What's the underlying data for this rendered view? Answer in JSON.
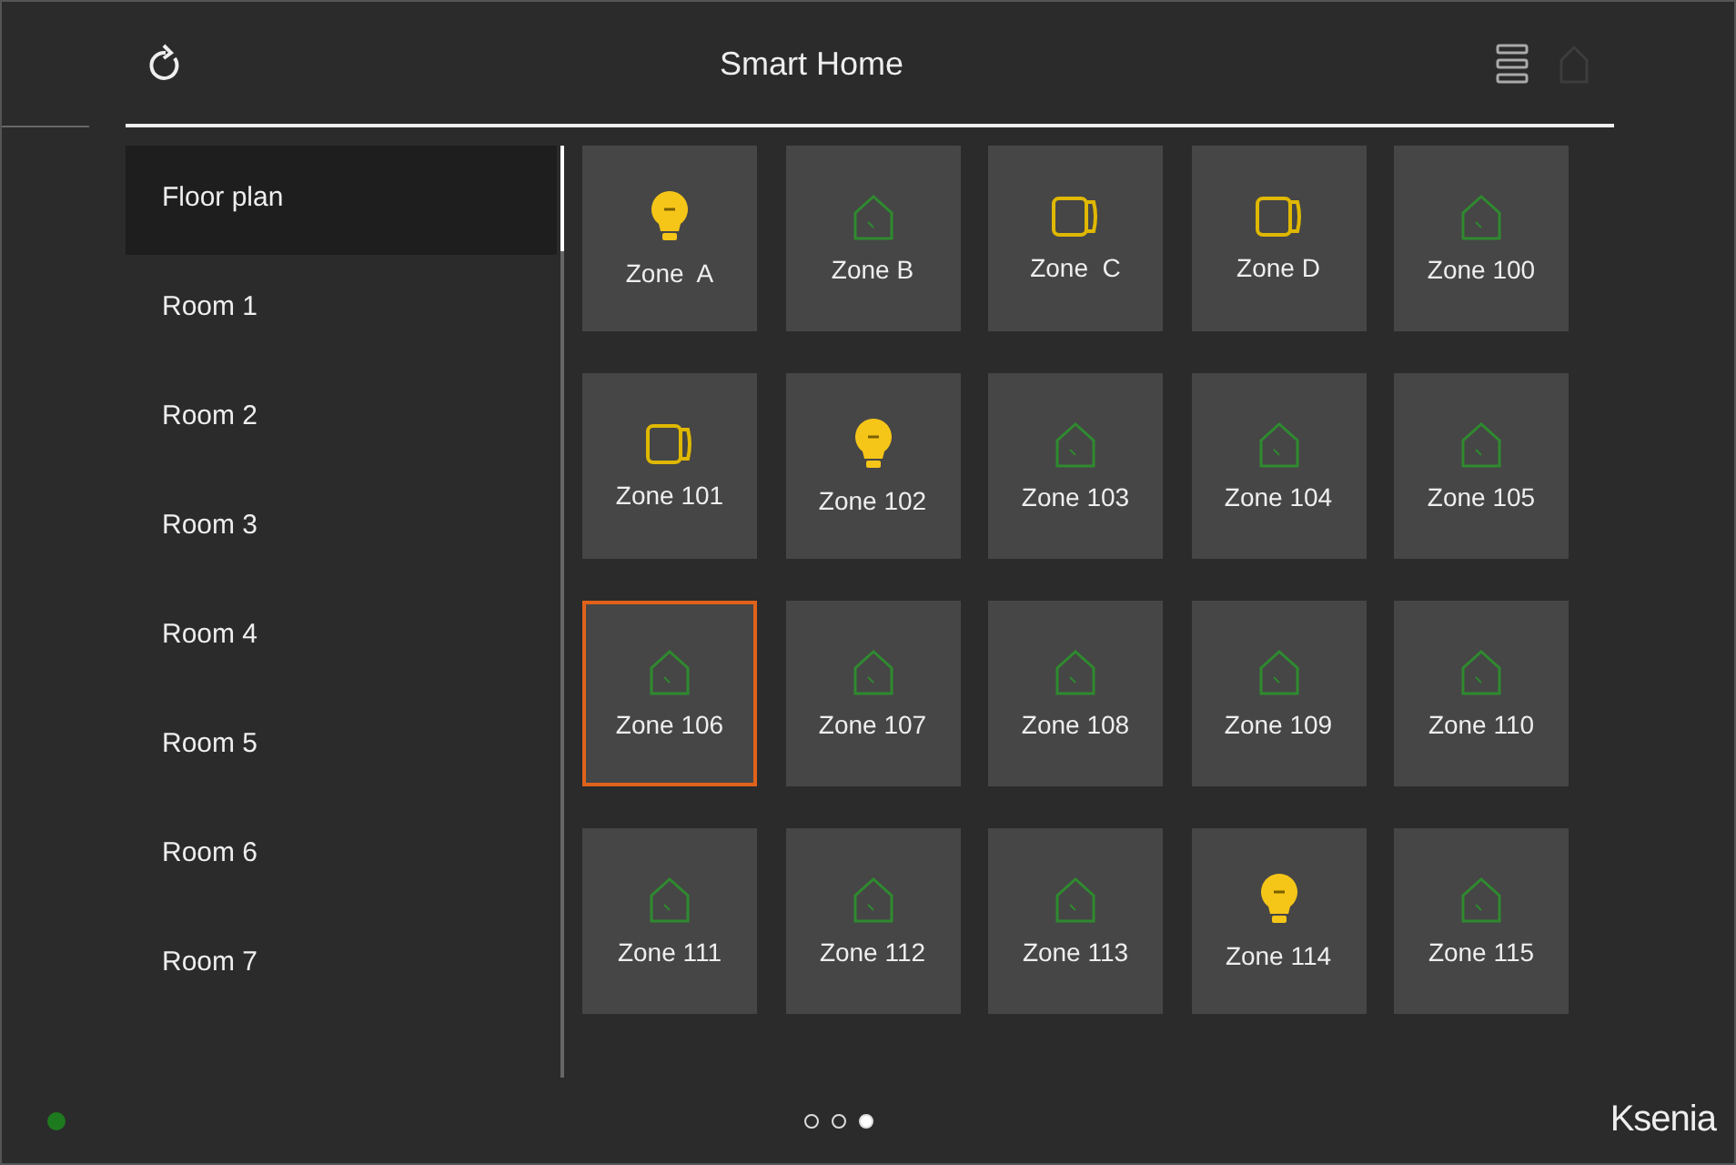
{
  "header": {
    "title": "Smart Home"
  },
  "sidebar": {
    "items": [
      {
        "label": "Floor plan",
        "selected": true
      },
      {
        "label": "Room 1",
        "selected": false
      },
      {
        "label": "Room 2",
        "selected": false
      },
      {
        "label": "Room 3",
        "selected": false
      },
      {
        "label": "Room 4",
        "selected": false
      },
      {
        "label": "Room 5",
        "selected": false
      },
      {
        "label": "Room 6",
        "selected": false
      },
      {
        "label": "Room 7",
        "selected": false
      }
    ]
  },
  "tiles": [
    {
      "label": "Zone  A",
      "kind": "light",
      "selected": false
    },
    {
      "label": "Zone B",
      "kind": "zone",
      "selected": false
    },
    {
      "label": "Zone  C",
      "kind": "shutter",
      "selected": false
    },
    {
      "label": "Zone D",
      "kind": "shutter",
      "selected": false
    },
    {
      "label": "Zone 100",
      "kind": "zone",
      "selected": false
    },
    {
      "label": "Zone 101",
      "kind": "shutter",
      "selected": false
    },
    {
      "label": "Zone 102",
      "kind": "light",
      "selected": false
    },
    {
      "label": "Zone 103",
      "kind": "zone",
      "selected": false
    },
    {
      "label": "Zone 104",
      "kind": "zone",
      "selected": false
    },
    {
      "label": "Zone 105",
      "kind": "zone",
      "selected": false
    },
    {
      "label": "Zone 106",
      "kind": "zone",
      "selected": true
    },
    {
      "label": "Zone 107",
      "kind": "zone",
      "selected": false
    },
    {
      "label": "Zone 108",
      "kind": "zone",
      "selected": false
    },
    {
      "label": "Zone 109",
      "kind": "zone",
      "selected": false
    },
    {
      "label": "Zone 110",
      "kind": "zone",
      "selected": false
    },
    {
      "label": "Zone 111",
      "kind": "zone",
      "selected": false
    },
    {
      "label": "Zone 112",
      "kind": "zone",
      "selected": false
    },
    {
      "label": "Zone 113",
      "kind": "zone",
      "selected": false
    },
    {
      "label": "Zone 114",
      "kind": "light",
      "selected": false
    },
    {
      "label": "Zone 115",
      "kind": "zone",
      "selected": false
    }
  ],
  "pager": [
    {
      "selected": false
    },
    {
      "selected": false
    },
    {
      "selected": true
    }
  ],
  "footer": {
    "logo": "Ksenia"
  }
}
